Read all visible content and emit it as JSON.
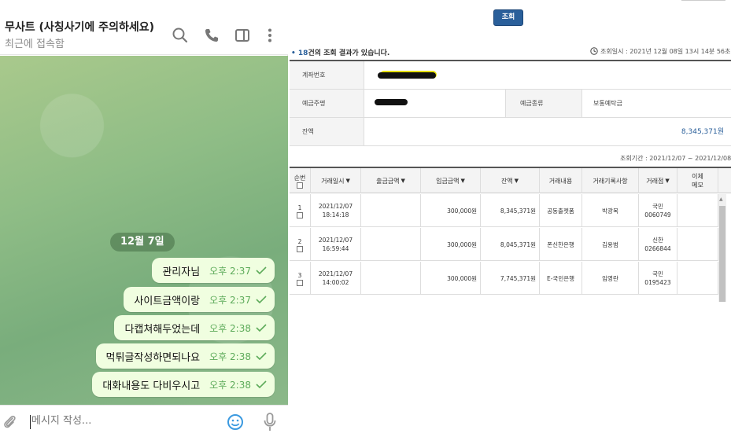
{
  "chat": {
    "title": "무사트 (사칭사기에 주의하세요)",
    "status": "최근에 접속함",
    "date_pill": "12월 7일",
    "messages": [
      {
        "text": "관리자님",
        "time": "오후 2:37"
      },
      {
        "text": "사이트금액이랑",
        "time": "오후 2:37"
      },
      {
        "text": "다캡쳐해두었는데",
        "time": "오후 2:38"
      },
      {
        "text": "먹튀글작성하면되나요",
        "time": "오후 2:38"
      },
      {
        "text": "대화내용도 다비우시고",
        "time": "오후 2:38"
      }
    ],
    "composer_placeholder": "메시지 작성...",
    "icons": [
      "search-icon",
      "phone-icon",
      "sidebar-toggle-icon",
      "more-vert-icon",
      "paperclip-icon",
      "emoji-icon",
      "microphone-icon",
      "double-check-icon"
    ],
    "colors": {
      "bubble": "#f0fee0",
      "time": "#5dab5a",
      "header_bg": "#ffffff"
    }
  },
  "bank": {
    "inquiry_button": "조회",
    "result_prefix": "•",
    "result_count": "18",
    "result_text": "건의 조회 결과가 있습니다.",
    "inquiry_time": "조회일시 : 2021년 12월 08일 13시 14분 56초",
    "account_label": "계좌번호",
    "owner_label": "예금주명",
    "type_label": "예금종류",
    "type_value": "보통예탁금",
    "balance_label": "잔액",
    "balance_value": "8,345,371원",
    "period": "조회기간 : 2021/12/07 ~ 2021/12/08",
    "headers": {
      "seq": "순번",
      "date": "거래일시",
      "withdraw": "출금금액",
      "deposit": "입금금액",
      "balance": "잔액",
      "content": "거래내용",
      "recorder": "거래기록사항",
      "branch": "거래점",
      "memo1": "이체",
      "memo2": "메모"
    },
    "rows": [
      {
        "seq": "1",
        "date": "2021/12/07",
        "time": "18:14:18",
        "withdraw": "",
        "deposit": "300,000원",
        "balance": "8,345,371원",
        "content": "공동출젯폼",
        "recorder": "박광복",
        "branch1": "국민",
        "branch2": "0060749"
      },
      {
        "seq": "2",
        "date": "2021/12/07",
        "time": "16:59:44",
        "withdraw": "",
        "deposit": "300,000원",
        "balance": "8,045,371원",
        "content": "폰신한은행",
        "recorder": "김용범",
        "branch1": "신한",
        "branch2": "0266844"
      },
      {
        "seq": "3",
        "date": "2021/12/07",
        "time": "14:00:02",
        "withdraw": "",
        "deposit": "300,000원",
        "balance": "7,745,371원",
        "content": "E-국민은행",
        "recorder": "임영란",
        "branch1": "국민",
        "branch2": "0195423"
      }
    ],
    "colors": {
      "accent": "#2a5f9a",
      "header_bg": "#f4f4f4"
    }
  }
}
